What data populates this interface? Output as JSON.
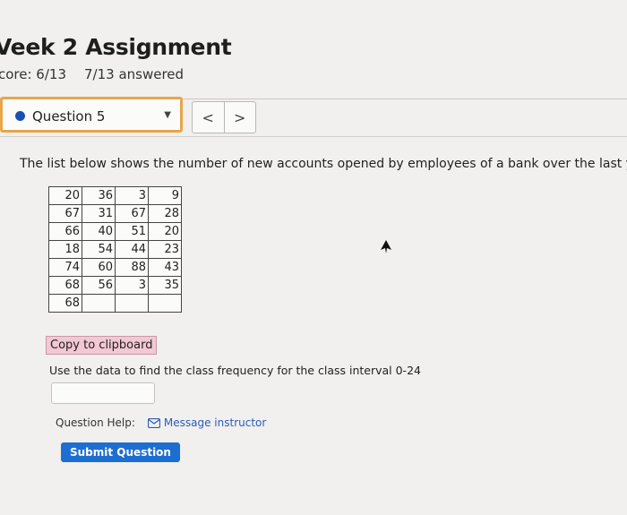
{
  "header": {
    "title": "Veek 2 Assignment",
    "score": "core: 6/13",
    "answered": "7/13 answered"
  },
  "question_nav": {
    "selected": "Question 5",
    "prev": "<",
    "next": ">"
  },
  "question": {
    "text": "The list below shows the number of new accounts opened by employees of a bank over the last year.",
    "table": [
      [
        "20",
        "36",
        "3",
        "9"
      ],
      [
        "67",
        "31",
        "67",
        "28"
      ],
      [
        "66",
        "40",
        "51",
        "20"
      ],
      [
        "18",
        "54",
        "44",
        "23"
      ],
      [
        "74",
        "60",
        "88",
        "43"
      ],
      [
        "68",
        "56",
        "3",
        "35"
      ],
      [
        "68",
        "",
        "",
        ""
      ]
    ],
    "copy_label": "Copy to clipboard",
    "instruction": "Use the data to find the class frequency for the class interval 0-24",
    "answer_value": ""
  },
  "help": {
    "label": "Question Help:",
    "message": "Message instructor"
  },
  "submit_label": "Submit Question",
  "colors": {
    "accent_orange": "#e7a64a",
    "dot_blue": "#1d4fb3",
    "submit_blue": "#1d6ed1",
    "copy_pink": "#f3c7d4",
    "link_blue": "#2b5cb8"
  }
}
